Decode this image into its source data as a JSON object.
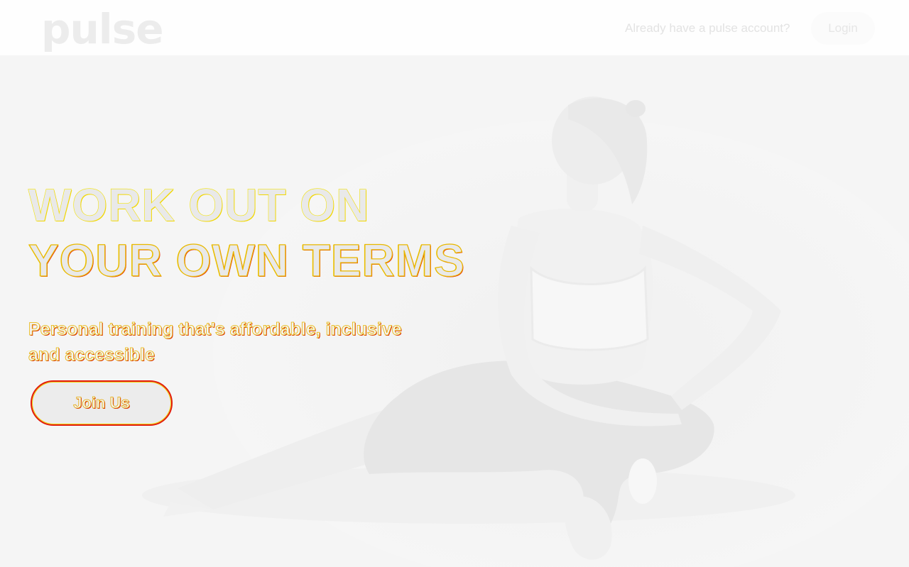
{
  "header": {
    "logo_text": "pulse",
    "account_prompt": "Already have a pulse account?",
    "login_label": "Login"
  },
  "hero": {
    "headline_line1": "WORK OUT ON",
    "headline_line2": "YOUR OWN TERMS",
    "tagline": "Personal training that's affordable, inclusive and accessible",
    "cta_label": "Join Us"
  },
  "colors": {
    "background": "#f5f5f5",
    "header_background": "#fefefe",
    "text_outline_yellow": "#f2e30a",
    "text_outline_red": "#e21b0b"
  }
}
